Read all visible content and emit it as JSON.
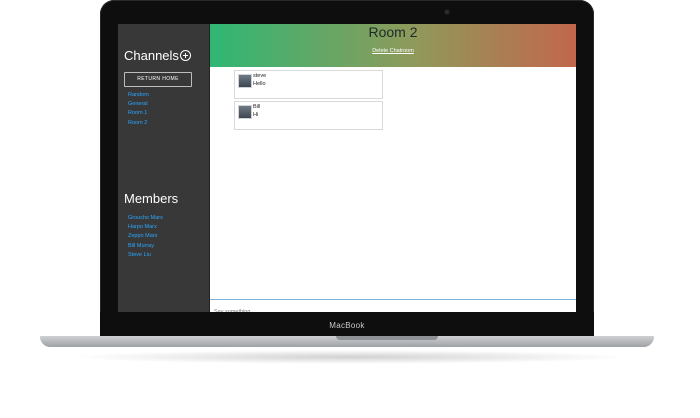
{
  "device": {
    "brand_label": "MacBook"
  },
  "sidebar": {
    "channels_heading": "Channels",
    "return_home_label": "RETURN HOME",
    "channels": [
      "Random",
      "General",
      "Room 1",
      "Room 2"
    ],
    "members_heading": "Members",
    "members": [
      "Groucho Marx",
      "Harpo Marx",
      "Zeppo Marx",
      "Bill Murray",
      "Steve Liu"
    ]
  },
  "room": {
    "title": "Room 2",
    "delete_label": "Delete Chatroom",
    "messages": [
      {
        "author": "steve",
        "text": "Hello"
      },
      {
        "author": "Bill",
        "text": "Hi"
      }
    ]
  },
  "composer": {
    "placeholder": "Say something..."
  },
  "colors": {
    "sidebar_bg": "#383838",
    "link": "#2aa7ff",
    "header_gradient_start": "#2fb774",
    "header_gradient_end": "#c2674b"
  }
}
